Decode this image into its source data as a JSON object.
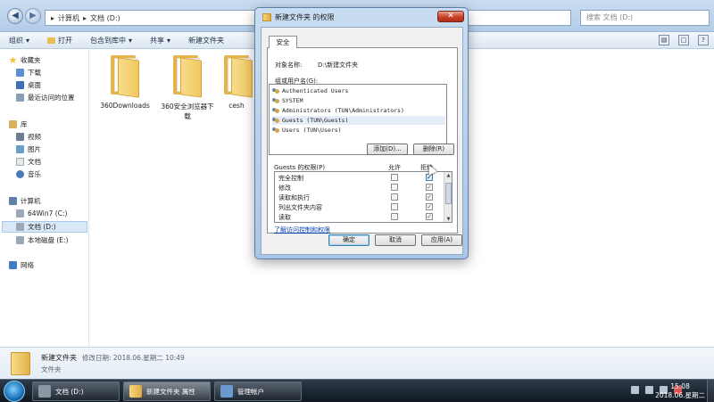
{
  "explorer": {
    "breadcrumb": [
      "计算机",
      "文档 (D:)"
    ],
    "search_placeholder": "搜索 文档 (D:)",
    "toolbar": [
      "组织",
      "打开",
      "包含到库中",
      "共享",
      "新建文件夹"
    ],
    "nav": {
      "favorites": "收藏夹",
      "downloads": "下载",
      "desktop": "桌面",
      "recent": "最近访问的位置",
      "libraries": "库",
      "videos": "视频",
      "pictures": "图片",
      "documents": "文档",
      "music": "音乐",
      "computer": "计算机",
      "drive_c": "64Win7 (C:)",
      "drive_d": "文档 (D:)",
      "drive_e": "本地磁盘 (E:)",
      "network": "网络"
    },
    "files": [
      "360Downloads",
      "360安全浏览器下载",
      "cesh"
    ],
    "details": {
      "name": "新建文件夹",
      "meta": "修改日期: 2018.06.星期二 10:49",
      "type": "文件夹"
    }
  },
  "dialog": {
    "title": "新建文件夹 的权限",
    "tab": "安全",
    "object_label": "对象名称:",
    "object_value": "D:\\新建文件夹",
    "groups_label": "组或用户名(G):",
    "groups": [
      "Authenticated Users",
      "SYSTEM",
      "Administrators (TUN\\Administrators)",
      "Guests (TUN\\Guests)",
      "Users (TUN\\Users)"
    ],
    "add_button": "添加(D)...",
    "remove_button": "删除(R)",
    "perm_label": "Guests 的权限(P)",
    "allow_header": "允许",
    "deny_header": "拒绝",
    "permissions": [
      {
        "name": "完全控制",
        "allow": false,
        "deny": true
      },
      {
        "name": "修改",
        "allow": false,
        "deny": true
      },
      {
        "name": "读取和执行",
        "allow": false,
        "deny": true
      },
      {
        "name": "列出文件夹内容",
        "allow": false,
        "deny": true
      },
      {
        "name": "读取",
        "allow": false,
        "deny": true
      }
    ],
    "link": "了解访问控制和权限",
    "ok": "确定",
    "cancel": "取消",
    "apply": "应用(A)"
  },
  "taskbar": {
    "items": [
      "文档 (D:)",
      "新建文件夹 属性",
      "管理帐户"
    ],
    "time": "15:08",
    "date": "2018.06.星期二"
  }
}
